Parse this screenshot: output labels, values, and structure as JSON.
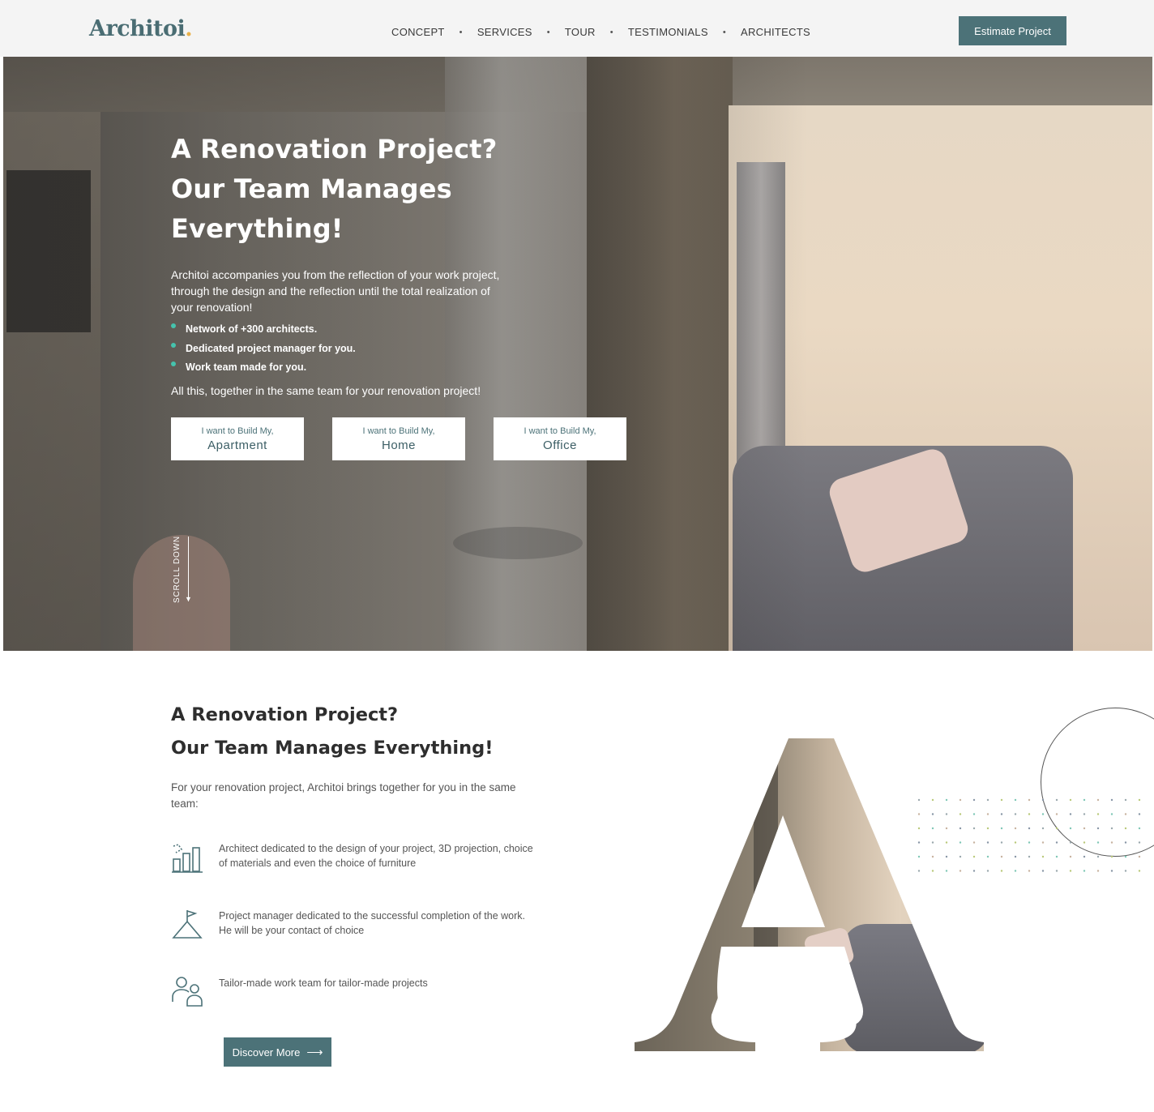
{
  "header": {
    "logo_text": "Architoi",
    "logo_dot": ".",
    "nav": [
      "CONCEPT",
      "SERVICES",
      "TOUR",
      "TESTIMONIALS",
      "ARCHITECTS"
    ],
    "nav_separator": "•",
    "cta_label": "Estimate Project"
  },
  "hero": {
    "title": "A Renovation Project? Our Team Manages Everything!",
    "description": "Architoi accompanies you from the reflection of your work project, through the design and the reflection until the total realization of your renovation!",
    "bullets": [
      "Network of +300 architects.",
      "Dedicated project manager for you.",
      "Work team made for you."
    ],
    "tagline": "All this, together in the same team for your renovation project!",
    "build_cards": [
      {
        "prefix": "I want to Build My,",
        "label": "Apartment"
      },
      {
        "prefix": "I want to Build My,",
        "label": "Home"
      },
      {
        "prefix": "I want to Build My,",
        "label": "Office"
      }
    ],
    "scroll_label": "SCROLL DOWN"
  },
  "section": {
    "title_line1": "A Renovation Project?",
    "title_line2": "Our Team Manages Everything!",
    "intro": "For your renovation project, Architoi brings together for you in the same team:",
    "features": [
      {
        "icon": "architect-plan-icon",
        "text": "Architect dedicated to the design of your project, 3D projection, choice of materials and even the choice of furniture"
      },
      {
        "icon": "flag-mountain-icon",
        "text": "Project manager dedicated to the successful completion of the work. He will be your contact of choice"
      },
      {
        "icon": "team-people-icon",
        "text": "Tailor-made work team for tailor-made projects"
      }
    ],
    "discover_label": "Discover More"
  },
  "colors": {
    "brand": "#4c7278",
    "accent_dot": "#e8b14a",
    "bullet": "#45c3ad",
    "header_bg": "#f4f4f4"
  }
}
